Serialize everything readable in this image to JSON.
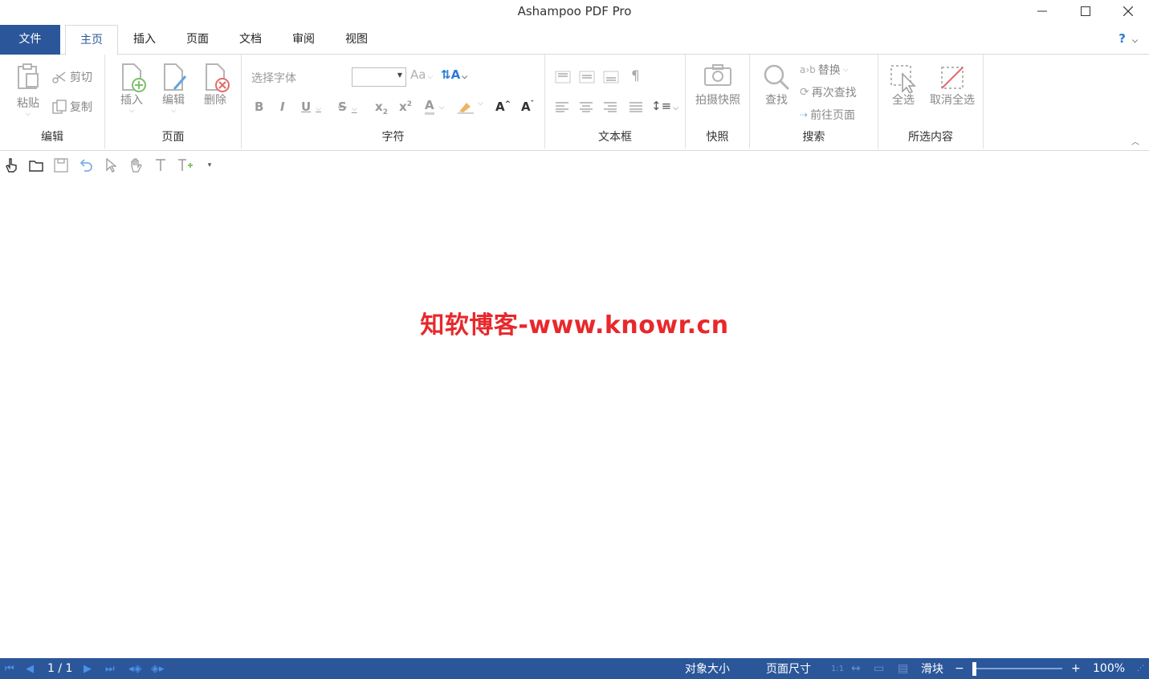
{
  "window": {
    "title": "Ashampoo PDF Pro"
  },
  "tabs": {
    "file": "文件",
    "home": "主页",
    "insert": "插入",
    "page": "页面",
    "document": "文档",
    "review": "审阅",
    "view": "视图",
    "help": "?"
  },
  "ribbon": {
    "edit": {
      "label": "编辑",
      "paste": "粘贴",
      "cut": "剪切",
      "copy": "复制"
    },
    "page": {
      "label": "页面",
      "insert": "插入",
      "edit": "编辑",
      "delete": "删除"
    },
    "font": {
      "label": "字符",
      "font_placeholder": "选择字体",
      "size_value": ""
    },
    "textbox": {
      "label": "文本框"
    },
    "snapshot": {
      "label": "快照",
      "take": "拍摄快照"
    },
    "search": {
      "label": "搜索",
      "find": "查找",
      "replace": "替换",
      "find_again": "再次查找",
      "goto_page": "前往页面"
    },
    "selection": {
      "label": "所选内容",
      "select_all": "全选",
      "deselect_all": "取消全选"
    }
  },
  "watermark": "知软博客-www.knowr.cn",
  "status": {
    "page_indicator": "1 / 1",
    "object_size": "对象大小",
    "page_size": "页面尺寸",
    "slider_label": "滑块",
    "zoom_minus": "−",
    "zoom_plus": "+",
    "zoom": "100%",
    "zoom_fraction": 0.0
  },
  "colors": {
    "accent": "#2b579a",
    "watermark": "#e8282b",
    "help": "#2b7bd6"
  }
}
